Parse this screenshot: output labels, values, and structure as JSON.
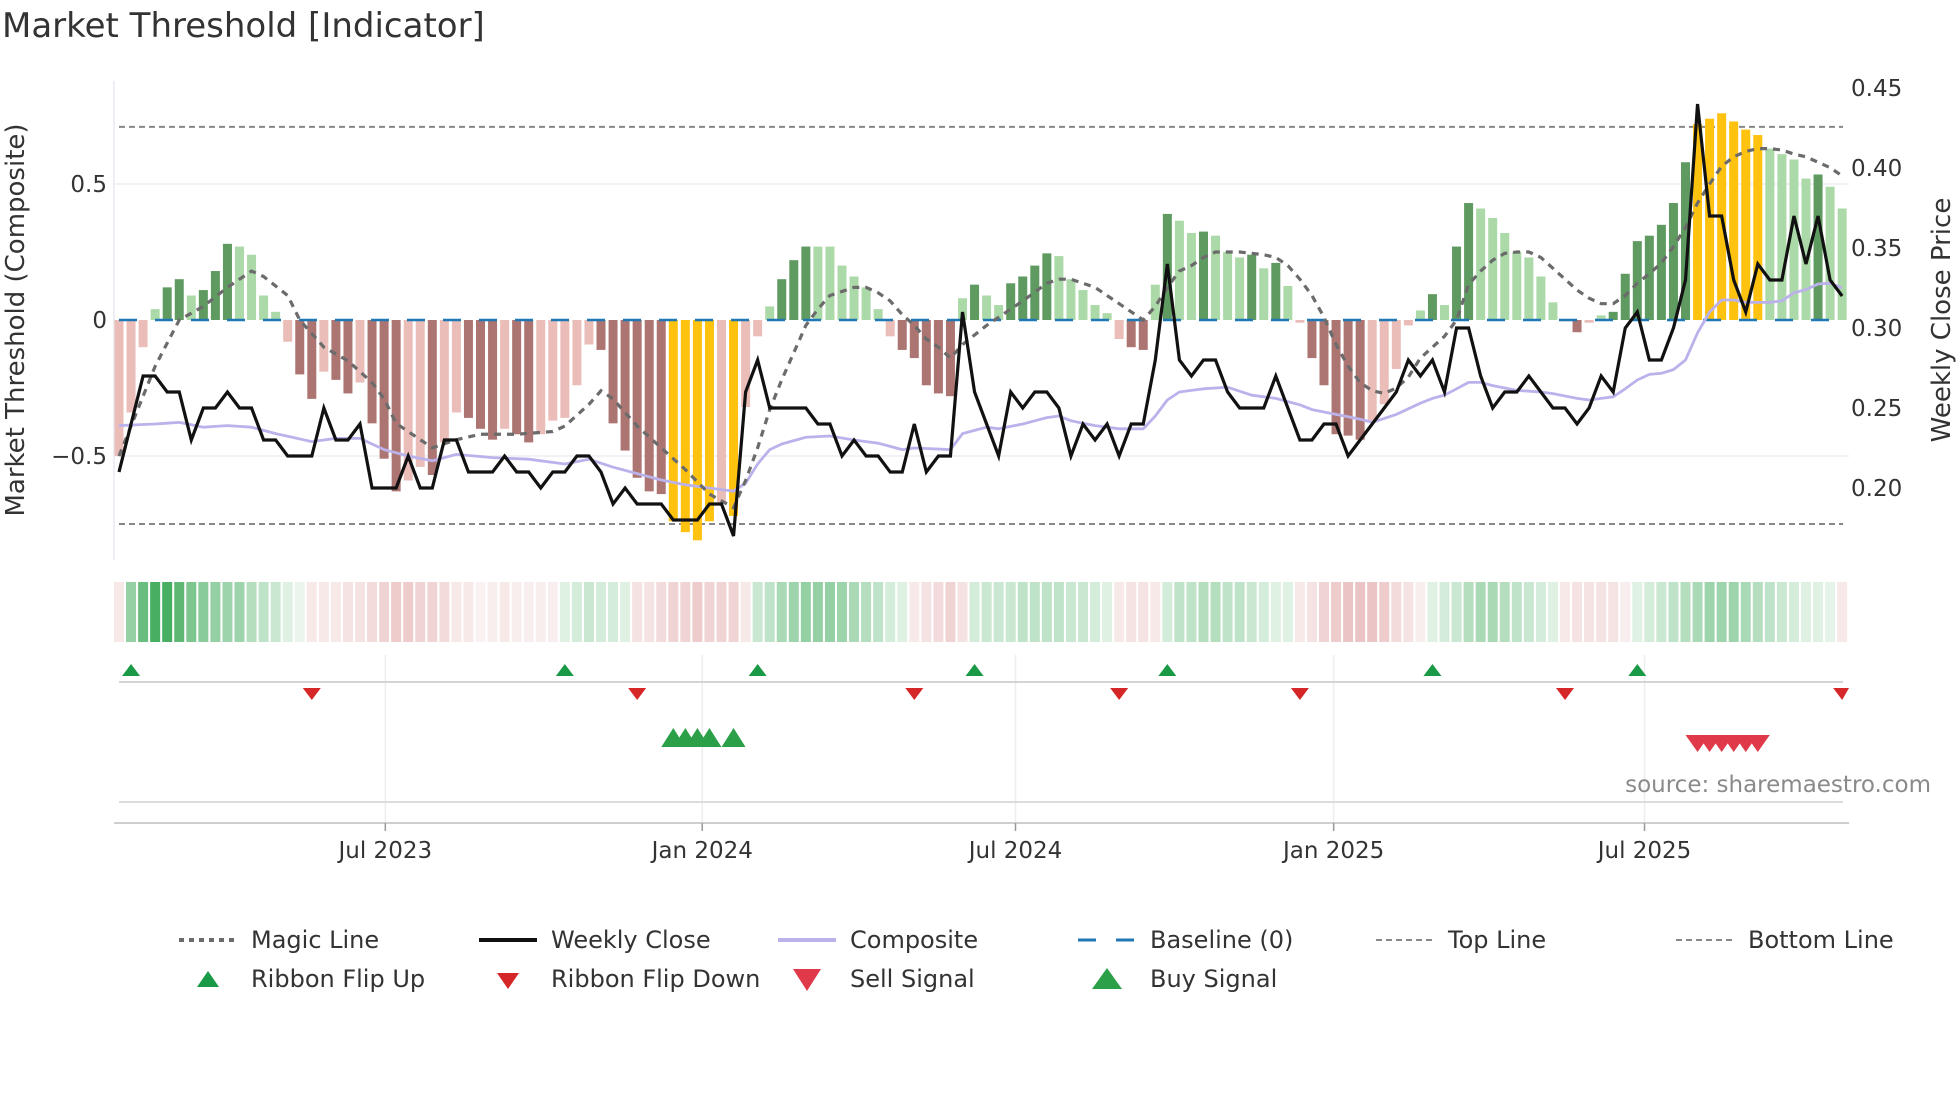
{
  "title": "Market Threshold [Indicator]",
  "source": "source: sharemaestro.com",
  "legend": [
    {
      "label": "Magic Line"
    },
    {
      "label": "Weekly Close"
    },
    {
      "label": "Composite"
    },
    {
      "label": "Baseline (0)"
    },
    {
      "label": "Top Line"
    },
    {
      "label": "Bottom Line"
    },
    {
      "label": "Ribbon Flip Up"
    },
    {
      "label": "Ribbon Flip Down"
    },
    {
      "label": "Sell Signal"
    },
    {
      "label": "Buy Signal"
    }
  ],
  "chart_data": {
    "type": "bar",
    "title": "Market Threshold [Indicator]",
    "ylabel": "Market Threshold (Composite)",
    "y2label": "Weekly Close Price",
    "x_unit": "week index",
    "ylim": [
      -0.88,
      0.88
    ],
    "y2lim": [
      0.155,
      0.455
    ],
    "y_ticks": [
      {
        "label": "0.5",
        "value": 0.5
      },
      {
        "label": "0",
        "value": 0
      },
      {
        "label": "−0.5",
        "value": -0.5
      }
    ],
    "y2_ticks": [
      {
        "label": "0.45",
        "value": 0.45
      },
      {
        "label": "0.40",
        "value": 0.4
      },
      {
        "label": "0.35",
        "value": 0.35
      },
      {
        "label": "0.30",
        "value": 0.3
      },
      {
        "label": "0.25",
        "value": 0.25
      },
      {
        "label": "0.20",
        "value": 0.2
      }
    ],
    "x_ticks": [
      {
        "label": "Jul 2023",
        "week": 22.1
      },
      {
        "label": "Jan 2024",
        "week": 48.4
      },
      {
        "label": "Jul 2024",
        "week": 74.4
      },
      {
        "label": "Jan 2025",
        "week": 100.8
      },
      {
        "label": "Jul 2025",
        "week": 126.6
      }
    ],
    "top_line": 0.71,
    "bottom_line": -0.75,
    "baseline": 0,
    "extreme_threshold": 0.68,
    "colors": {
      "pos_strong": "#5f9a61",
      "pos_weak": "#acd9a8",
      "neg_strong": "#ad7572",
      "neg_weak": "#ebbdb9",
      "extreme": "#ffc20e",
      "close": "#111111",
      "composite": "#bbb2ec",
      "magic": "#6b6b6b",
      "baseline": "#1f77b4",
      "guide": "#888888",
      "ribbon_up": "#28a046",
      "ribbon_down": "#cd6e6e",
      "flip_up": "#1a9a46",
      "flip_down": "#d62728",
      "buy": "#2ca048",
      "sell": "#e0394a"
    },
    "histogram": [
      -0.5,
      -0.34,
      -0.1,
      0.04,
      0.12,
      0.15,
      0.09,
      0.11,
      0.18,
      0.28,
      0.27,
      0.24,
      0.09,
      0.03,
      -0.08,
      -0.2,
      -0.29,
      -0.19,
      -0.22,
      -0.27,
      -0.23,
      -0.38,
      -0.51,
      -0.63,
      -0.59,
      -0.54,
      -0.57,
      -0.45,
      -0.34,
      -0.36,
      -0.4,
      -0.44,
      -0.4,
      -0.42,
      -0.45,
      -0.42,
      -0.37,
      -0.36,
      -0.24,
      -0.09,
      -0.11,
      -0.38,
      -0.48,
      -0.58,
      -0.63,
      -0.64,
      -0.74,
      -0.78,
      -0.81,
      -0.74,
      -0.67,
      -0.72,
      -0.32,
      -0.06,
      0.05,
      0.15,
      0.22,
      0.27,
      0.27,
      0.27,
      0.2,
      0.16,
      0.12,
      0.04,
      -0.06,
      -0.11,
      -0.14,
      -0.24,
      -0.27,
      -0.28,
      0.08,
      0.13,
      0.09,
      0.055,
      0.135,
      0.16,
      0.2,
      0.245,
      0.235,
      0.15,
      0.11,
      0.055,
      0.025,
      -0.07,
      -0.1,
      -0.11,
      0.13,
      0.39,
      0.365,
      0.32,
      0.325,
      0.31,
      0.25,
      0.23,
      0.24,
      0.19,
      0.21,
      0.125,
      -0.01,
      -0.14,
      -0.24,
      -0.42,
      -0.425,
      -0.44,
      -0.37,
      -0.31,
      -0.18,
      -0.02,
      0.035,
      0.095,
      0.055,
      0.27,
      0.43,
      0.41,
      0.375,
      0.32,
      0.25,
      0.23,
      0.16,
      0.065,
      -0.005,
      -0.045,
      -0.01,
      0.017,
      0.03,
      0.17,
      0.29,
      0.31,
      0.35,
      0.43,
      0.58,
      0.72,
      0.74,
      0.76,
      0.73,
      0.7,
      0.68,
      0.63,
      0.61,
      0.59,
      0.52,
      0.535,
      0.49,
      0.41
    ],
    "weekly_close": [
      0.21,
      0.24,
      0.27,
      0.27,
      0.26,
      0.26,
      0.23,
      0.25,
      0.25,
      0.26,
      0.25,
      0.25,
      0.23,
      0.23,
      0.22,
      0.22,
      0.22,
      0.25,
      0.23,
      0.23,
      0.24,
      0.2,
      0.2,
      0.2,
      0.22,
      0.2,
      0.2,
      0.23,
      0.23,
      0.21,
      0.21,
      0.21,
      0.22,
      0.21,
      0.21,
      0.2,
      0.21,
      0.21,
      0.22,
      0.22,
      0.21,
      0.19,
      0.2,
      0.19,
      0.19,
      0.19,
      0.18,
      0.18,
      0.18,
      0.19,
      0.19,
      0.17,
      0.26,
      0.28,
      0.25,
      0.25,
      0.25,
      0.25,
      0.24,
      0.24,
      0.22,
      0.23,
      0.22,
      0.22,
      0.21,
      0.21,
      0.24,
      0.21,
      0.22,
      0.22,
      0.31,
      0.26,
      0.24,
      0.22,
      0.26,
      0.25,
      0.26,
      0.26,
      0.25,
      0.22,
      0.24,
      0.23,
      0.24,
      0.22,
      0.24,
      0.24,
      0.28,
      0.34,
      0.28,
      0.27,
      0.28,
      0.28,
      0.26,
      0.25,
      0.25,
      0.25,
      0.27,
      0.25,
      0.23,
      0.23,
      0.24,
      0.24,
      0.22,
      0.23,
      0.24,
      0.25,
      0.26,
      0.28,
      0.27,
      0.28,
      0.26,
      0.3,
      0.3,
      0.27,
      0.25,
      0.26,
      0.26,
      0.27,
      0.26,
      0.25,
      0.25,
      0.24,
      0.25,
      0.27,
      0.26,
      0.3,
      0.31,
      0.28,
      0.28,
      0.3,
      0.33,
      0.44,
      0.37,
      0.37,
      0.33,
      0.31,
      0.34,
      0.33,
      0.33,
      0.37,
      0.34,
      0.37,
      0.33,
      0.32
    ],
    "magic_line": {
      "weeks": [
        0,
        3,
        5,
        7,
        9,
        11,
        12,
        14,
        15,
        17,
        19,
        21,
        22,
        23,
        25,
        26,
        28,
        30,
        33,
        36,
        37,
        39,
        40,
        41,
        43,
        45,
        47,
        49,
        51,
        52,
        53,
        54,
        55,
        56,
        57,
        58,
        59,
        61,
        62,
        63,
        64,
        65,
        66,
        67,
        68,
        69,
        70,
        72,
        73,
        74,
        75,
        77,
        78,
        79,
        80,
        81,
        82,
        83,
        84,
        85,
        86,
        87,
        88,
        89,
        90,
        91,
        93,
        95,
        96,
        97,
        98,
        99,
        100,
        101,
        102,
        103,
        104,
        105,
        106,
        107,
        108,
        109,
        110,
        111,
        112,
        113,
        114,
        115,
        116,
        117,
        118,
        119,
        120,
        121,
        122,
        123,
        124,
        125,
        126,
        127,
        128,
        129,
        130,
        131,
        132,
        133,
        134,
        135,
        136,
        137,
        138,
        139,
        140,
        141,
        142,
        143
      ],
      "values": [
        -0.5,
        -0.17,
        0.0,
        0.05,
        0.12,
        0.18,
        0.16,
        0.09,
        0.0,
        -0.1,
        -0.15,
        -0.23,
        -0.29,
        -0.38,
        -0.44,
        -0.47,
        -0.44,
        -0.42,
        -0.42,
        -0.41,
        -0.39,
        -0.31,
        -0.26,
        -0.29,
        -0.39,
        -0.47,
        -0.55,
        -0.64,
        -0.69,
        -0.59,
        -0.47,
        -0.33,
        -0.22,
        -0.12,
        -0.02,
        0.04,
        0.09,
        0.12,
        0.12,
        0.1,
        0.07,
        0.02,
        -0.02,
        -0.07,
        -0.1,
        -0.14,
        -0.09,
        -0.02,
        0.01,
        0.04,
        0.07,
        0.135,
        0.15,
        0.15,
        0.135,
        0.12,
        0.09,
        0.06,
        0.03,
        0.0,
        0.05,
        0.12,
        0.18,
        0.2,
        0.23,
        0.25,
        0.25,
        0.24,
        0.23,
        0.2,
        0.15,
        0.09,
        0.01,
        -0.09,
        -0.17,
        -0.23,
        -0.26,
        -0.27,
        -0.25,
        -0.21,
        -0.14,
        -0.1,
        -0.06,
        0.0,
        0.13,
        0.18,
        0.22,
        0.245,
        0.25,
        0.25,
        0.23,
        0.19,
        0.15,
        0.11,
        0.08,
        0.06,
        0.06,
        0.09,
        0.135,
        0.17,
        0.21,
        0.27,
        0.34,
        0.43,
        0.5,
        0.565,
        0.6,
        0.62,
        0.63,
        0.63,
        0.625,
        0.61,
        0.6,
        0.58,
        0.56,
        0.53
      ]
    },
    "composite": {
      "weeks": [
        0,
        3,
        5,
        7,
        9,
        11,
        13,
        16,
        18,
        20,
        22,
        24,
        26,
        28,
        31,
        34,
        37,
        39,
        41,
        43,
        45,
        47,
        49,
        51,
        52,
        53,
        54,
        55,
        57,
        59,
        61,
        63,
        65,
        66,
        69,
        70,
        72,
        73,
        75,
        77,
        78,
        79,
        81,
        83,
        85,
        86,
        87,
        88,
        90,
        92,
        94,
        96,
        98,
        99,
        101,
        103,
        104,
        106,
        108,
        109,
        110,
        111,
        112,
        113,
        114,
        116,
        118,
        119,
        121,
        122,
        124,
        125,
        126,
        127,
        128,
        129,
        130,
        131,
        132,
        133,
        134,
        135,
        137,
        138,
        139,
        140,
        141,
        142,
        143
      ],
      "values": [
        0.239,
        0.24,
        0.241,
        0.238,
        0.239,
        0.238,
        0.234,
        0.229,
        0.231,
        0.231,
        0.224,
        0.22,
        0.217,
        0.221,
        0.219,
        0.218,
        0.215,
        0.218,
        0.213,
        0.209,
        0.205,
        0.202,
        0.2,
        0.198,
        0.203,
        0.215,
        0.224,
        0.2275,
        0.2317,
        0.2325,
        0.23,
        0.228,
        0.224,
        0.225,
        0.224,
        0.234,
        0.238,
        0.237,
        0.24,
        0.244,
        0.245,
        0.242,
        0.239,
        0.237,
        0.237,
        0.245,
        0.255,
        0.26,
        0.262,
        0.263,
        0.258,
        0.256,
        0.252,
        0.249,
        0.246,
        0.243,
        0.241,
        0.246,
        0.253,
        0.256,
        0.258,
        0.262,
        0.266,
        0.266,
        0.264,
        0.261,
        0.26,
        0.259,
        0.256,
        0.255,
        0.257,
        0.262,
        0.2675,
        0.271,
        0.2717,
        0.274,
        0.28,
        0.297,
        0.31,
        0.3175,
        0.3175,
        0.316,
        0.316,
        0.317,
        0.322,
        0.324,
        0.3275,
        0.328,
        0.325
      ]
    },
    "ribbon": [
      -0.15,
      0.5,
      0.7,
      0.85,
      0.85,
      0.75,
      0.6,
      0.55,
      0.5,
      0.45,
      0.45,
      0.35,
      0.3,
      0.25,
      0.15,
      0.1,
      -0.15,
      -0.15,
      -0.15,
      -0.2,
      -0.2,
      -0.25,
      -0.3,
      -0.35,
      -0.35,
      -0.3,
      -0.3,
      -0.25,
      -0.15,
      -0.15,
      -0.1,
      -0.12,
      -0.15,
      -0.12,
      -0.12,
      -0.12,
      -0.12,
      0.15,
      0.2,
      0.25,
      0.2,
      0.2,
      0.15,
      -0.2,
      -0.2,
      -0.25,
      -0.3,
      -0.3,
      -0.35,
      -0.3,
      -0.3,
      -0.3,
      -0.15,
      0.25,
      0.3,
      0.4,
      0.45,
      0.5,
      0.5,
      0.5,
      0.45,
      0.4,
      0.35,
      0.3,
      0.2,
      0.15,
      -0.15,
      -0.2,
      -0.25,
      -0.3,
      -0.2,
      0.2,
      0.25,
      0.25,
      0.25,
      0.3,
      0.3,
      0.3,
      0.3,
      0.25,
      0.25,
      0.2,
      0.15,
      -0.15,
      -0.2,
      -0.2,
      -0.15,
      0.2,
      0.3,
      0.3,
      0.35,
      0.35,
      0.3,
      0.3,
      0.25,
      0.2,
      0.15,
      0.15,
      -0.15,
      -0.2,
      -0.3,
      -0.35,
      -0.4,
      -0.4,
      -0.4,
      -0.35,
      -0.25,
      -0.2,
      -0.12,
      0.15,
      0.2,
      0.25,
      0.35,
      0.4,
      0.4,
      0.35,
      0.3,
      0.25,
      0.2,
      0.15,
      -0.15,
      -0.2,
      -0.2,
      -0.2,
      -0.2,
      -0.12,
      0.15,
      0.2,
      0.25,
      0.3,
      0.35,
      0.4,
      0.45,
      0.45,
      0.45,
      0.4,
      0.35,
      0.3,
      0.25,
      0.2,
      0.15,
      0.15,
      0.12,
      -0.15
    ],
    "ribbon_flip_up_weeks": [
      1,
      37,
      53,
      71,
      87,
      109,
      126
    ],
    "ribbon_flip_down_weeks": [
      16,
      43,
      66,
      83,
      98,
      120,
      143
    ],
    "buy_signal_weeks": [
      46,
      47,
      48,
      49,
      51
    ],
    "sell_signal_weeks": [
      131,
      132,
      133,
      134,
      135,
      136
    ]
  }
}
